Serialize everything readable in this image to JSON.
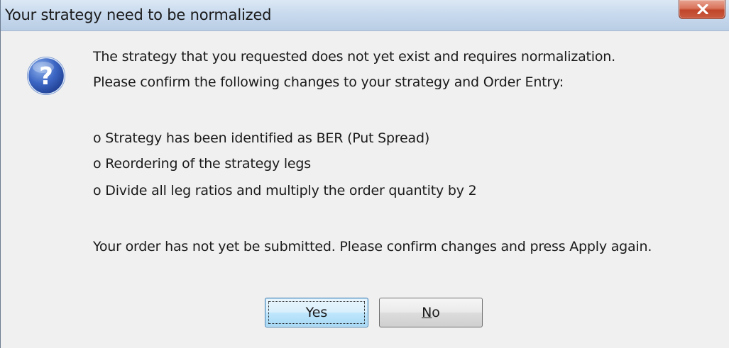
{
  "window": {
    "title": "Your strategy need to be normalized",
    "close_label": "X"
  },
  "icon": {
    "name": "question-icon",
    "glyph": "?"
  },
  "message": {
    "line1": "The strategy that you requested does not yet exist and requires normalization.",
    "line2": "Please confirm the following changes to your strategy and Order Entry:",
    "items": [
      "o  Strategy has been identified as BER (Put Spread)",
      "o  Reordering of the strategy legs",
      "o  Divide all leg ratios and multiply the order quantity by 2"
    ],
    "footer": "Your order has not yet be submitted. Please confirm changes and press Apply again."
  },
  "buttons": {
    "yes_label": "Yes",
    "no_label_mnemonic": "N",
    "no_label_rest": "o"
  },
  "colors": {
    "close_button": "#c95b40",
    "default_button": "#bee6fd",
    "title_bar": "#c8daee"
  }
}
